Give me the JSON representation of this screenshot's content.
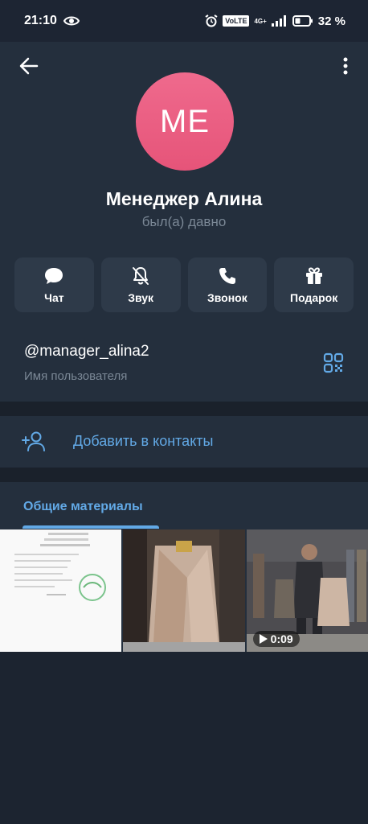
{
  "status": {
    "time": "21:10",
    "battery": "32 %",
    "volte": "VoLTE",
    "network": "4G+"
  },
  "profile": {
    "initials": "ME",
    "name": "Менеджер Алина",
    "last_seen": "был(а) давно",
    "avatar_color": "#e8597e"
  },
  "actions": [
    {
      "label": "Чат",
      "icon": "chat-bubble-icon"
    },
    {
      "label": "Звук",
      "icon": "bell-muted-icon"
    },
    {
      "label": "Звонок",
      "icon": "phone-icon"
    },
    {
      "label": "Подарок",
      "icon": "gift-icon"
    }
  ],
  "username": {
    "value": "@manager_alina2",
    "hint": "Имя пользователя"
  },
  "add_contact": {
    "label": "Добавить в контакты"
  },
  "media": {
    "tab": "Общие материалы",
    "items": [
      {
        "kind": "document-photo"
      },
      {
        "kind": "photo"
      },
      {
        "kind": "video",
        "duration": "0:09"
      }
    ]
  },
  "colors": {
    "accent": "#62a9e6",
    "background": "#1c2430",
    "surface": "#242f3d",
    "button": "#2e3a49"
  }
}
